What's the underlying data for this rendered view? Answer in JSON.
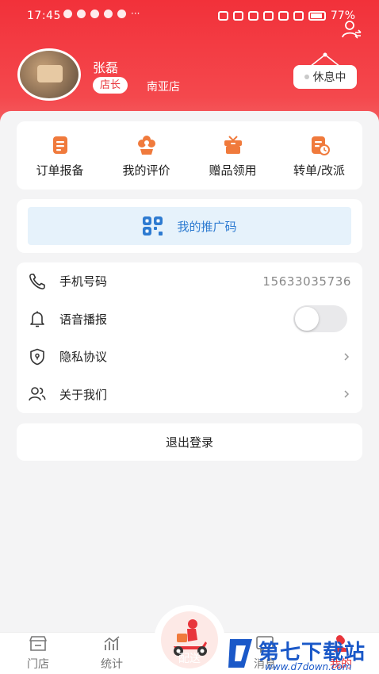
{
  "status_bar": {
    "time": "17:45",
    "more_indicator": "···",
    "battery": "77%"
  },
  "header": {
    "user_name": "张磊",
    "role": "店长",
    "store": "南亚店",
    "rest_status": "休息中"
  },
  "quick_actions": [
    {
      "label": "订单报备",
      "icon": "order-report-icon"
    },
    {
      "label": "我的评价",
      "icon": "flower-review-icon"
    },
    {
      "label": "赠品领用",
      "icon": "gift-icon"
    },
    {
      "label": "转单/改派",
      "icon": "transfer-icon"
    }
  ],
  "promo": {
    "label": "我的推广码",
    "icon": "qr-code-icon"
  },
  "settings": {
    "phone": {
      "label": "手机号码",
      "value": "15633035736",
      "icon": "phone-icon"
    },
    "voice": {
      "label": "语音播报",
      "enabled": false,
      "icon": "bell-icon"
    },
    "privacy": {
      "label": "隐私协议",
      "icon": "shield-icon"
    },
    "about": {
      "label": "关于我们",
      "icon": "people-icon"
    }
  },
  "logout": {
    "label": "退出登录"
  },
  "tabbar": {
    "items": [
      {
        "label": "门店",
        "icon": "store-icon"
      },
      {
        "label": "统计",
        "icon": "stats-icon"
      },
      {
        "label": "配送",
        "icon": "delivery-scooter-icon"
      },
      {
        "label": "消息",
        "icon": "message-icon"
      },
      {
        "label": "我的",
        "icon": "profile-icon"
      }
    ],
    "active_index": 4
  },
  "watermark": {
    "text": "第七下载站",
    "url": "www.d7down.com"
  },
  "colors": {
    "brand_red": "#e8353b",
    "promo_blue": "#2e7bd1",
    "promo_bg": "#e6f2fb",
    "icon_orange": "#f07a3c"
  }
}
